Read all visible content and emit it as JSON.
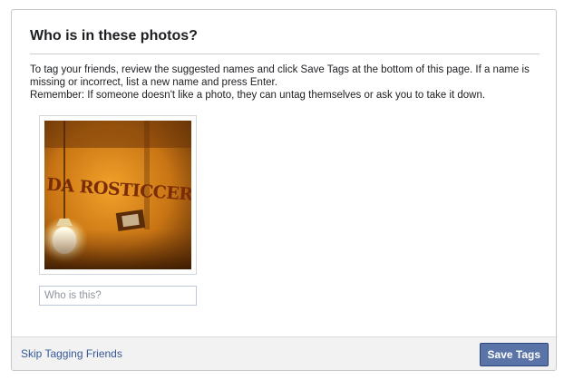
{
  "dialog": {
    "title": "Who is in these photos?",
    "instructions": {
      "line1": "To tag your friends, review the suggested names and click Save Tags at the bottom of this page. If a name is missing or incorrect, list a new name and press Enter.",
      "line2": "Remember: If someone doesn't like a photo, they can untag themselves or ask you to take it down."
    },
    "photo": {
      "sign_text": "DA ROSTICCERIA"
    },
    "who_input": {
      "value": "",
      "placeholder": "Who is this?"
    },
    "footer": {
      "skip_label": "Skip Tagging Friends",
      "save_label": "Save Tags"
    }
  },
  "colors": {
    "accent_button": "#5b74a8",
    "link": "#385898",
    "footer_bg": "#f2f2f2"
  }
}
